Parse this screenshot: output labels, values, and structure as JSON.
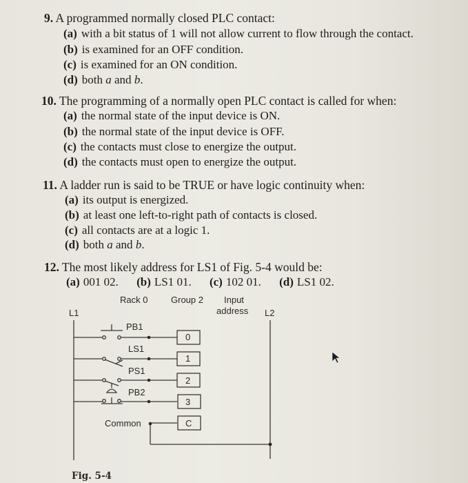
{
  "questions": [
    {
      "number": "9.",
      "stem": "A programmed normally closed PLC contact:",
      "options": [
        {
          "label": "(a)",
          "text": "with a bit status of 1 will not allow current to flow through the contact."
        },
        {
          "label": "(b)",
          "text": "is examined for an OFF condition."
        },
        {
          "label": "(c)",
          "text": "is examined for an ON condition."
        },
        {
          "label": "(d)",
          "text_pre": "both ",
          "var1": "a",
          "text_mid": " and ",
          "var2": "b",
          "text_post": "."
        }
      ]
    },
    {
      "number": "10.",
      "stem": "The programming of a normally open PLC contact is called for when:",
      "options": [
        {
          "label": "(a)",
          "text": "the normal state of the input device is ON."
        },
        {
          "label": "(b)",
          "text": "the normal state of the input device is OFF."
        },
        {
          "label": "(c)",
          "text": "the contacts must close to energize the output."
        },
        {
          "label": "(d)",
          "text": "the contacts must open to energize the output."
        }
      ]
    },
    {
      "number": "11.",
      "stem": "A ladder run is said to be TRUE or have logic continuity when:",
      "options": [
        {
          "label": "(a)",
          "text": "its output is energized."
        },
        {
          "label": "(b)",
          "text": "at least one left-to-right path of contacts is closed."
        },
        {
          "label": "(c)",
          "text": "all contacts are at a logic 1."
        },
        {
          "label": "(d)",
          "text_pre": "both ",
          "var1": "a",
          "text_mid": " and ",
          "var2": "b",
          "text_post": "."
        }
      ]
    },
    {
      "number": "12.",
      "stem": "The most likely address for LS1 of Fig. 5-4 would be:",
      "options": [
        {
          "label": "(a)",
          "text": "001 02."
        },
        {
          "label": "(b)",
          "text": "LS1 01."
        },
        {
          "label": "(c)",
          "text": "102 01."
        },
        {
          "label": "(d)",
          "text": "LS1 02."
        }
      ]
    }
  ],
  "figure": {
    "caption": "Fig. 5-4",
    "header_rack": "Rack 0",
    "header_group": "Group 2",
    "header_input_1": "Input",
    "header_input_2": "address",
    "rail_left": "L1",
    "rail_right": "L2",
    "devices": [
      {
        "name": "PB1",
        "type": "pushbutton-NO",
        "terminal": "0"
      },
      {
        "name": "LS1",
        "type": "limit-switch-NO",
        "terminal": "1"
      },
      {
        "name": "PS1",
        "type": "pressure-switch-NO",
        "terminal": "2"
      },
      {
        "name": "PB2",
        "type": "pushbutton-NC",
        "terminal": "3"
      }
    ],
    "common_label": "Common",
    "common_terminal": "C"
  },
  "colors": {
    "paper": "#e9e6df",
    "ink": "#1f1d1a",
    "diagram_ink": "#3a3733"
  }
}
